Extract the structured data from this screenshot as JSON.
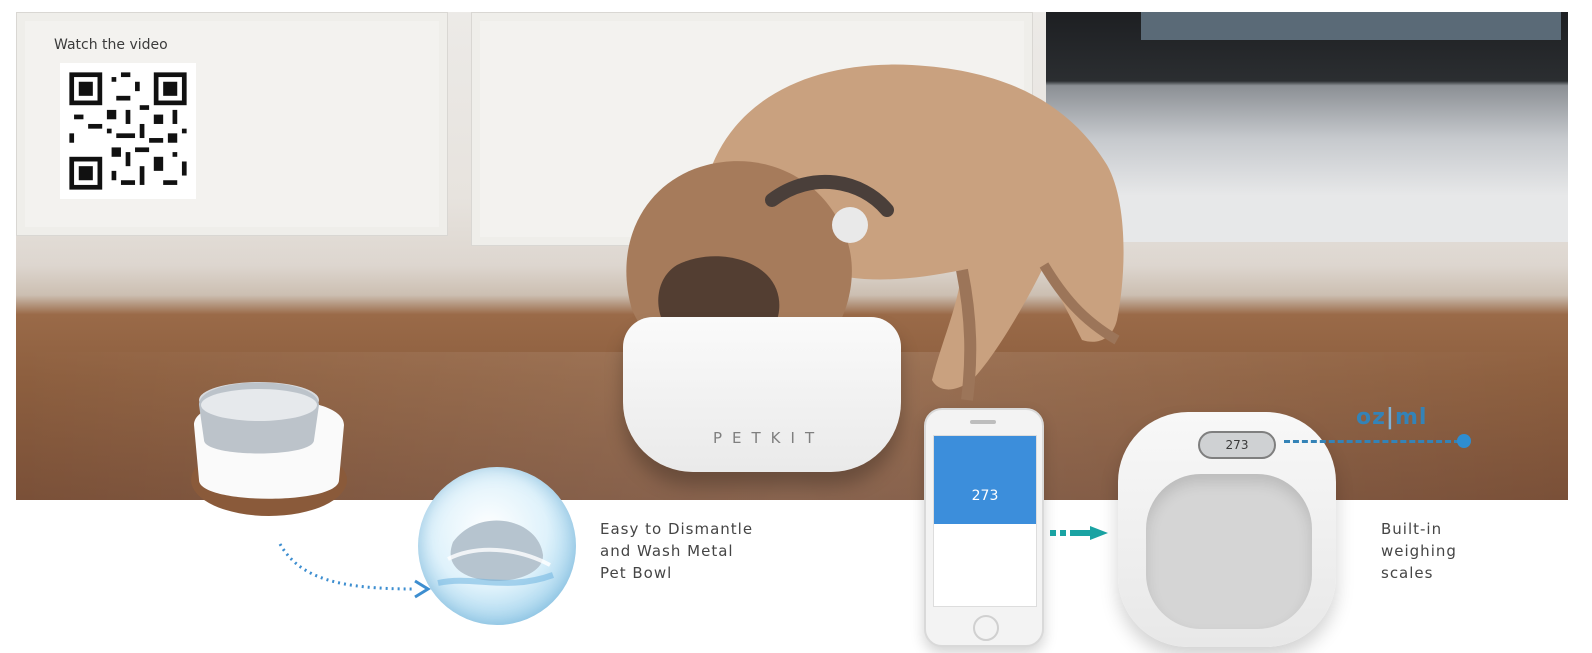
{
  "overlay": {
    "video_label": "Watch the video"
  },
  "product": {
    "brand_text": "PETKIT"
  },
  "features": {
    "dismantle_text_lines": [
      "Easy to Dismantle",
      "and Wash Metal",
      "Pet Bowl"
    ],
    "weighing_text_lines": [
      "Built-in",
      "weighing",
      "scales"
    ]
  },
  "scale": {
    "display_value": "273",
    "app_value": "273",
    "unit_labels": [
      "oz",
      "ml"
    ]
  },
  "colors": {
    "accent_blue": "#3483b7",
    "teal_arrow": "#1aa3a3"
  }
}
